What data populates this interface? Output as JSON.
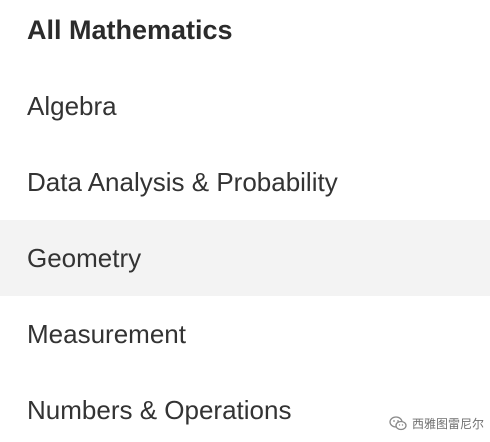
{
  "menu": {
    "items": [
      {
        "label": "All Mathematics"
      },
      {
        "label": "Algebra"
      },
      {
        "label": "Data Analysis & Probability"
      },
      {
        "label": "Geometry"
      },
      {
        "label": "Measurement"
      },
      {
        "label": "Numbers & Operations"
      }
    ]
  },
  "watermark": {
    "icon": "wechat-icon",
    "text": "西雅图雷尼尔"
  },
  "colors": {
    "text": "#333333",
    "hover_background": "#f3f3f3"
  }
}
